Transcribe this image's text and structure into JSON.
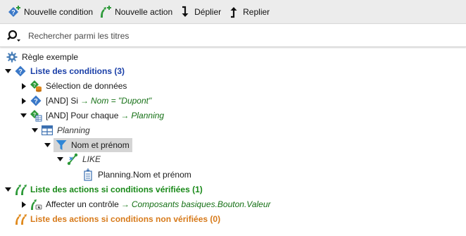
{
  "toolbar": {
    "new_condition": "Nouvelle condition",
    "new_action": "Nouvelle action",
    "expand": "Déplier",
    "collapse": "Replier"
  },
  "search": {
    "placeholder": "Rechercher parmi les titres",
    "value": ""
  },
  "tree": {
    "rule": "Règle exemple",
    "conditions_list": "Liste des conditions (3)",
    "data_selection": "Sélection de données",
    "if_prefix": "[AND] Si",
    "if_arrow": "→",
    "if_expr": "Nom = \"Dupont\"",
    "foreach_prefix": "[AND] Pour chaque",
    "foreach_arrow": "→",
    "foreach_target": "Planning",
    "planning": "Planning",
    "filter": "Nom et prénom",
    "like": "LIKE",
    "field": "Planning.Nom et prénom",
    "actions_true": "Liste des actions si conditions vérifiées (1)",
    "assign_prefix": "Affecter un contrôle",
    "assign_arrow": "→",
    "assign_target": "Composants basiques.Bouton.Valeur",
    "actions_false": "Liste des actions si conditions non vérifiées (0)"
  },
  "colors": {
    "conditions": "#1a3fa8",
    "actions_true": "#1a8a1a",
    "actions_false": "#d77a1a",
    "condition_icon": "#3a78c8",
    "action_icon": "#2e9a3a",
    "filter_icon": "#2f86d6"
  }
}
